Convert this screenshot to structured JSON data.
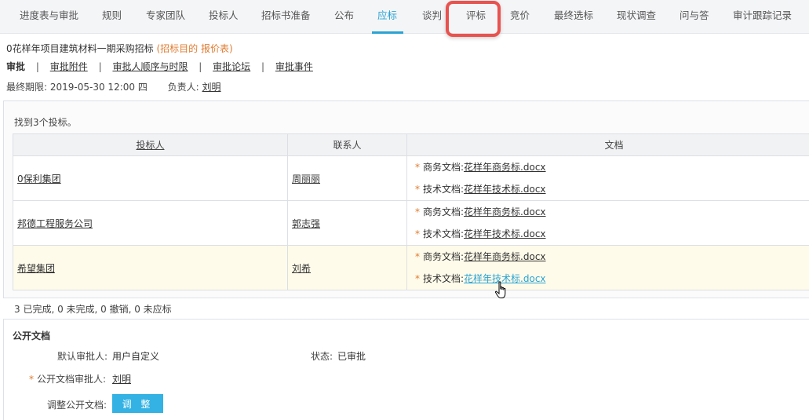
{
  "tabs": [
    {
      "label": "进度表与审批"
    },
    {
      "label": "规则"
    },
    {
      "label": "专家团队"
    },
    {
      "label": "投标人"
    },
    {
      "label": "招标书准备"
    },
    {
      "label": "公布"
    },
    {
      "label": "应标"
    },
    {
      "label": "谈判"
    },
    {
      "label": "评标"
    },
    {
      "label": "竞价"
    },
    {
      "label": "最终选标"
    },
    {
      "label": "现状调查"
    },
    {
      "label": "问与答"
    },
    {
      "label": "审计跟踪记录"
    }
  ],
  "active_tab": "应标",
  "highlighted_tab": "评标",
  "project": {
    "title": "0花样年项目建筑材料一期采购招标",
    "tag": "(招标目的 报价表)"
  },
  "subnav": {
    "items": [
      "审批",
      "审批附件",
      "审批人顺序与时限",
      "审批论坛",
      "审批事件"
    ],
    "separator": "|"
  },
  "meta": {
    "deadline_label": "最终期限:",
    "deadline_value": "2019-05-30 12:00 四",
    "owner_label": "负责人:",
    "owner_value": "刘明"
  },
  "bids": {
    "found_text": "找到3个投标。",
    "columns": [
      "投标人",
      "联系人",
      "文档"
    ],
    "rows": [
      {
        "bidder": "0保利集团",
        "contact": "周丽丽",
        "docs": [
          {
            "label": "商务文档:",
            "file": "花样年商务标.docx"
          },
          {
            "label": "技术文档:",
            "file": "花样年技术标.docx"
          }
        ]
      },
      {
        "bidder": "邦德工程服务公司",
        "contact": "郭志强",
        "docs": [
          {
            "label": "商务文档:",
            "file": "花样年商务标.docx"
          },
          {
            "label": "技术文档:",
            "file": "花样年技术标.docx"
          }
        ]
      },
      {
        "bidder": "希望集团",
        "contact": "刘希",
        "docs": [
          {
            "label": "商务文档:",
            "file": "花样年商务标.docx"
          },
          {
            "label": "技术文档:",
            "file": "花样年技术标.docx"
          }
        ]
      }
    ],
    "summary": "3 已完成, 0 未完成, 0 撤销, 0 未应标"
  },
  "public_docs": {
    "title": "公开文档",
    "default_approver_label": "默认审批人:",
    "default_approver_value": "用户自定义",
    "status_label": "状态:",
    "status_value": "已审批",
    "approver_label": "公开文档审批人:",
    "approver_value": "刘明",
    "adjust_label": "调整公开文档:",
    "adjust_button": "调 整"
  },
  "colors": {
    "accent": "#2aa3d3",
    "orange": "#e07b2f",
    "highlight_box": "#e8534f",
    "row_highlight": "#fffbea",
    "button": "#33b2e3"
  }
}
